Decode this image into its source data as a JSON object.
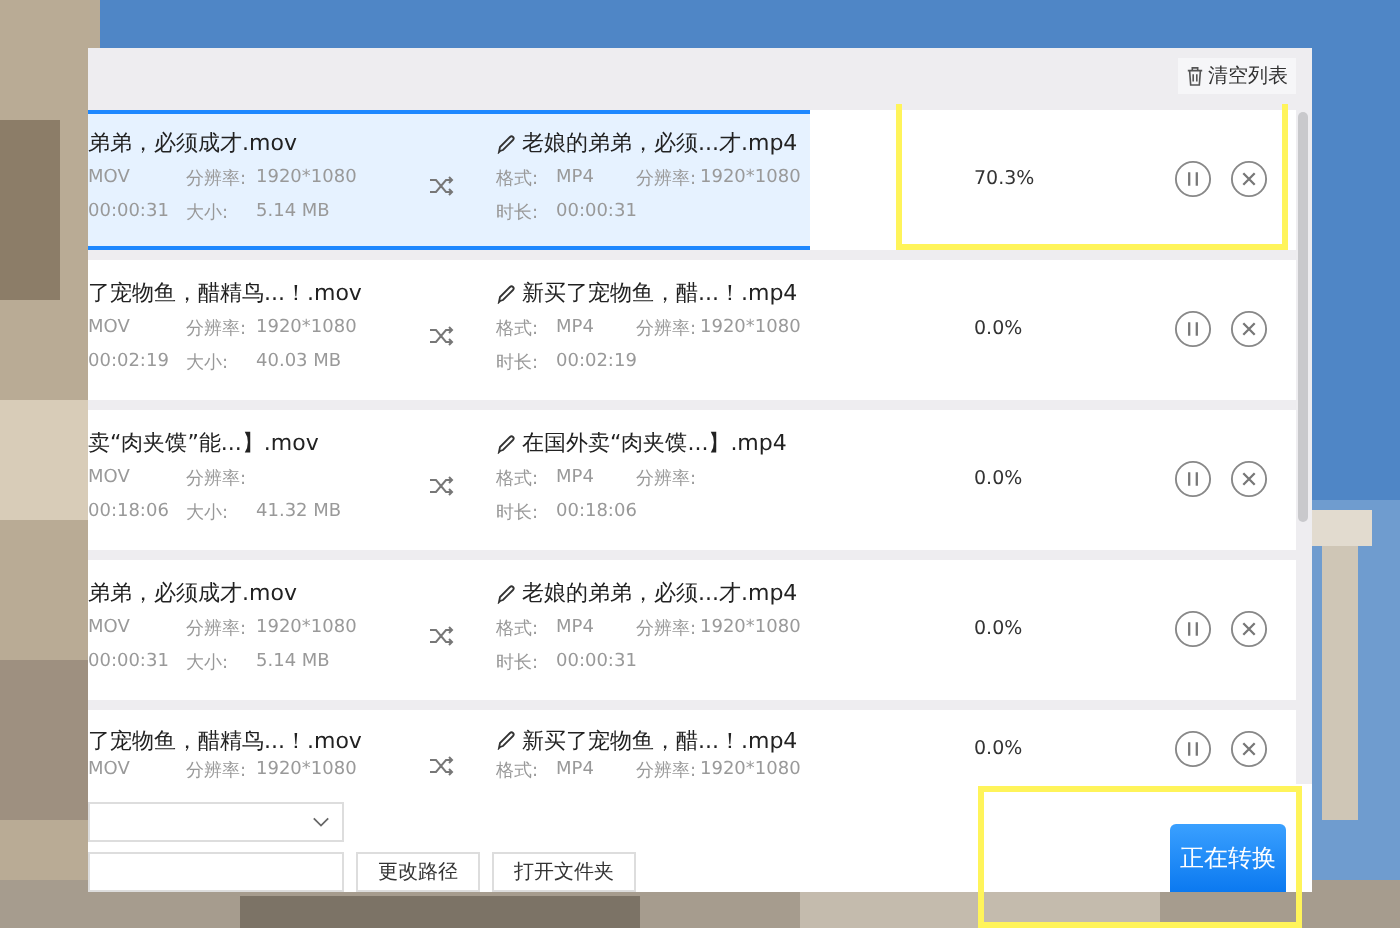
{
  "toolbar": {
    "clear_button": "清空列表"
  },
  "items": [
    {
      "selected": true,
      "highlight": true,
      "source": {
        "name": "弟弟，必须成才.mov",
        "format": "MOV",
        "res_label": "分辨率:",
        "resolution": "1920*1080",
        "duration": "00:00:31",
        "size_label": "大小:",
        "size": "5.14 MB"
      },
      "target": {
        "name": "老娘的弟弟，必须...才.mp4",
        "format_label": "格式:",
        "format": "MP4",
        "res_label": "分辨率:",
        "resolution": "1920*1080",
        "duration_label": "时长:",
        "duration": "00:00:31"
      },
      "progress": "70.3%"
    },
    {
      "selected": false,
      "highlight": false,
      "source": {
        "name": "了宠物鱼，醋精鸟...！.mov",
        "format": "MOV",
        "res_label": "分辨率:",
        "resolution": "1920*1080",
        "duration": "00:02:19",
        "size_label": "大小:",
        "size": "40.03 MB"
      },
      "target": {
        "name": "新买了宠物鱼，醋...！.mp4",
        "format_label": "格式:",
        "format": "MP4",
        "res_label": "分辨率:",
        "resolution": "1920*1080",
        "duration_label": "时长:",
        "duration": "00:02:19"
      },
      "progress": "0.0%"
    },
    {
      "selected": false,
      "highlight": false,
      "source": {
        "name": "卖“肉夹馍”能...】.mov",
        "format": "MOV",
        "res_label": "分辨率:",
        "duration": "00:18:06",
        "size_label": "大小:",
        "size": "41.32 MB"
      },
      "target": {
        "name": "在国外卖“肉夹馍...】.mp4",
        "format_label": "格式:",
        "format": "MP4",
        "res_label": "分辨率:",
        "duration_label": "时长:",
        "duration": "00:18:06"
      },
      "progress": "0.0%"
    },
    {
      "selected": false,
      "highlight": false,
      "source": {
        "name": "弟弟，必须成才.mov",
        "format": "MOV",
        "res_label": "分辨率:",
        "resolution": "1920*1080",
        "duration": "00:00:31",
        "size_label": "大小:",
        "size": "5.14 MB"
      },
      "target": {
        "name": "老娘的弟弟，必须...才.mp4",
        "format_label": "格式:",
        "format": "MP4",
        "res_label": "分辨率:",
        "resolution": "1920*1080",
        "duration_label": "时长:",
        "duration": "00:00:31"
      },
      "progress": "0.0%"
    },
    {
      "selected": false,
      "highlight": false,
      "source": {
        "name": "了宠物鱼，醋精鸟...！.mov",
        "format": "MOV",
        "res_label": "分辨率:",
        "resolution": "1920*1080"
      },
      "target": {
        "name": "新买了宠物鱼，醋...！.mp4",
        "format_label": "格式:",
        "format": "MP4",
        "res_label": "分辨率:",
        "resolution": "1920*1080"
      },
      "progress": "0.0%"
    }
  ],
  "footer": {
    "change_path_button": "更改路径",
    "open_folder_button": "打开文件夹",
    "convert_button": {
      "label": "正在转换",
      "highlight": true
    }
  }
}
